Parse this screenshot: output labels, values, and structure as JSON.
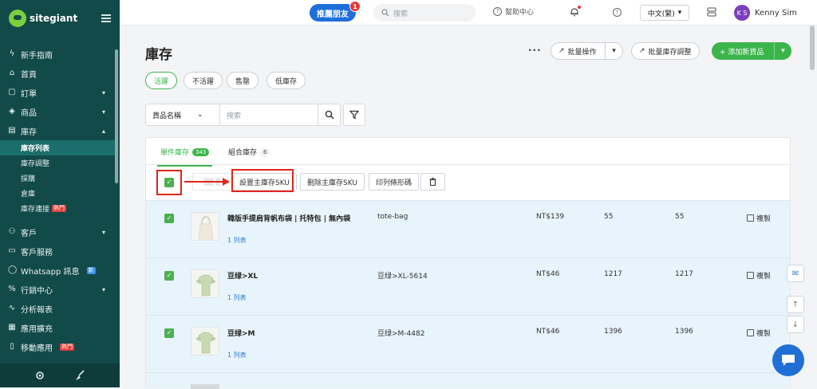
{
  "sidebar": {
    "brand": "sitegiant",
    "items": [
      {
        "label": "新手指南",
        "icon": "bolt-icon"
      },
      {
        "label": "首頁",
        "icon": "home-icon"
      },
      {
        "label": "訂單",
        "icon": "clipboard-icon",
        "expandable": true
      },
      {
        "label": "商品",
        "icon": "box-icon",
        "expandable": true
      },
      {
        "label": "庫存",
        "icon": "archive-icon",
        "expandable": true,
        "expanded": true
      }
    ],
    "inventory_sub": [
      {
        "label": "庫存列表",
        "active": true
      },
      {
        "label": "庫存調整"
      },
      {
        "label": "採購"
      },
      {
        "label": "倉庫"
      },
      {
        "label": "庫存連接",
        "badge": "熱門"
      }
    ],
    "items2": [
      {
        "label": "客戶",
        "icon": "users-icon",
        "expandable": true
      },
      {
        "label": "客戶服務",
        "icon": "message-icon"
      },
      {
        "label": "Whatsapp 訊息",
        "icon": "whatsapp-icon",
        "badge": "新"
      },
      {
        "label": "行銷中心",
        "icon": "percent-icon",
        "expandable": true
      },
      {
        "label": "分析報表",
        "icon": "pulse-icon"
      },
      {
        "label": "應用擴充",
        "icon": "grid-icon"
      },
      {
        "label": "移動應用",
        "icon": "mobile-icon",
        "badge": "熱門"
      }
    ]
  },
  "topbar": {
    "refer_label": "推薦朋友",
    "refer_count": "1",
    "search_placeholder": "搜索",
    "help_label": "幫助中心",
    "language": "中文(繁)",
    "user_initials": "K S",
    "user_name": "Kenny Sim"
  },
  "page": {
    "title": "庫存",
    "bulk_ops": "批量操作",
    "bulk_adjust": "批量庫存調整",
    "add_new": "+ 添加新貨品",
    "status_chips": [
      "活躍",
      "不活躍",
      "售罄",
      "低庫存"
    ],
    "filter_select": "貨品名稱",
    "filter_placeholder": "搜索"
  },
  "tabs": [
    {
      "label": "單件庫存",
      "count": "343",
      "active": true
    },
    {
      "label": "組合庫存",
      "count": "6"
    }
  ],
  "toolbar": {
    "btn_set_master": "設置主庫存SKU",
    "btn_remove_master": "刪除主庫存SKU",
    "btn_print_barcode": "印列條形碼"
  },
  "rows": [
    {
      "name": "韓版手提肩背帆布袋 | 托特包 | 無內袋",
      "link": "1 列表",
      "sku": "tote-bag",
      "price": "NT$139",
      "q1": "55",
      "q2": "55",
      "action": "複製"
    },
    {
      "name": "豆绿>XL",
      "link": "1 列表",
      "sku": "豆绿>XL-5614",
      "price": "NT$46",
      "q1": "1217",
      "q2": "1217",
      "action": "複製"
    },
    {
      "name": "豆绿>M",
      "link": "1 列表",
      "sku": "豆绿>M-4482",
      "price": "NT$46",
      "q1": "1396",
      "q2": "1396",
      "action": "複製"
    }
  ],
  "colors": {
    "sidebar": "#124a49",
    "accent": "#3bb54a",
    "primary": "#1e6fd9",
    "highlight": "#e1251b"
  }
}
